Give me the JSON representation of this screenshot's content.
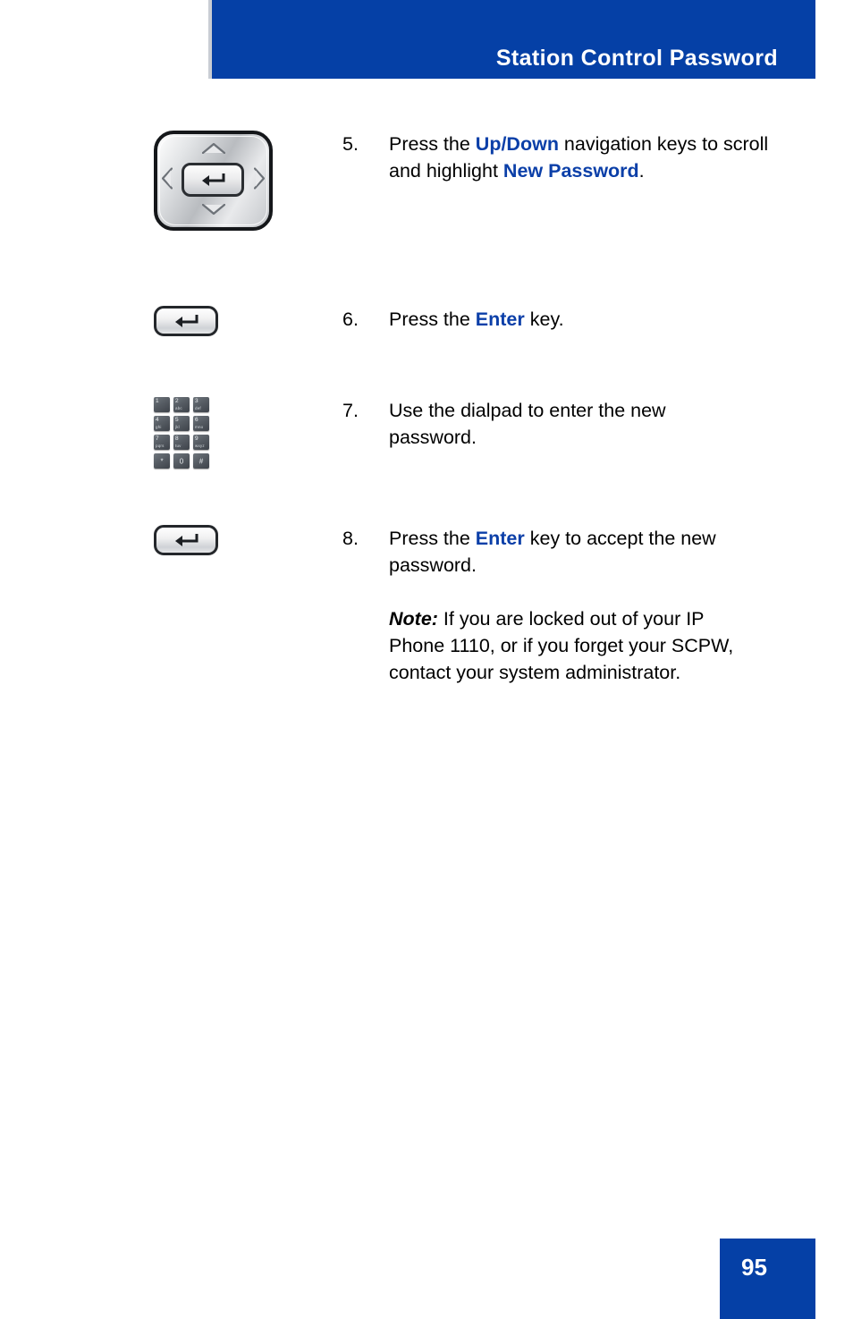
{
  "header": {
    "title": "Station Control Password"
  },
  "steps": [
    {
      "number": "5.",
      "icon": "navigation-cluster-icon",
      "text_parts": [
        {
          "t": "Press the ",
          "style": "plain"
        },
        {
          "t": "Up/Down",
          "style": "bold-blue"
        },
        {
          "t": " navigation keys to scroll and highlight ",
          "style": "plain"
        },
        {
          "t": "New Password",
          "style": "bold-blue"
        },
        {
          "t": ".",
          "style": "plain"
        }
      ],
      "plain_text": "Press the Up/Down navigation keys to scroll and highlight New Password."
    },
    {
      "number": "6.",
      "icon": "enter-key-icon",
      "text_parts": [
        {
          "t": "Press the ",
          "style": "plain"
        },
        {
          "t": "Enter",
          "style": "bold-blue"
        },
        {
          "t": " key.",
          "style": "plain"
        }
      ],
      "plain_text": "Press the Enter key."
    },
    {
      "number": "7.",
      "icon": "dialpad-icon",
      "text_parts": [
        {
          "t": "Use the dialpad to enter the new password.",
          "style": "plain"
        }
      ],
      "plain_text": "Use the dialpad to enter the new password."
    },
    {
      "number": "8.",
      "icon": "enter-key-icon",
      "text_parts": [
        {
          "t": "Press the ",
          "style": "plain"
        },
        {
          "t": "Enter",
          "style": "bold-blue"
        },
        {
          "t": " key to accept the new password.",
          "style": "plain"
        }
      ],
      "plain_text": "Press the Enter key to accept the new password."
    }
  ],
  "note": {
    "lead": "Note:",
    "body": " If you are locked out of your IP Phone 1110, or if you forget your SCPW, contact your system administrator."
  },
  "dialpad": {
    "keys": [
      {
        "digit": "1",
        "letters": ""
      },
      {
        "digit": "2",
        "letters": "abc"
      },
      {
        "digit": "3",
        "letters": "def"
      },
      {
        "digit": "4",
        "letters": "ghi"
      },
      {
        "digit": "5",
        "letters": "jkl"
      },
      {
        "digit": "6",
        "letters": "mno"
      },
      {
        "digit": "7",
        "letters": "pqrs"
      },
      {
        "digit": "8",
        "letters": "tuv"
      },
      {
        "digit": "9",
        "letters": "wxyz"
      },
      {
        "digit": "*",
        "letters": ""
      },
      {
        "digit": "0",
        "letters": ""
      },
      {
        "digit": "#",
        "letters": ""
      }
    ]
  },
  "footer": {
    "page_number": "95"
  },
  "colors": {
    "banner_blue": "#0540a6",
    "emphasis_blue": "#0b3fa8",
    "body_text": "#000000"
  }
}
